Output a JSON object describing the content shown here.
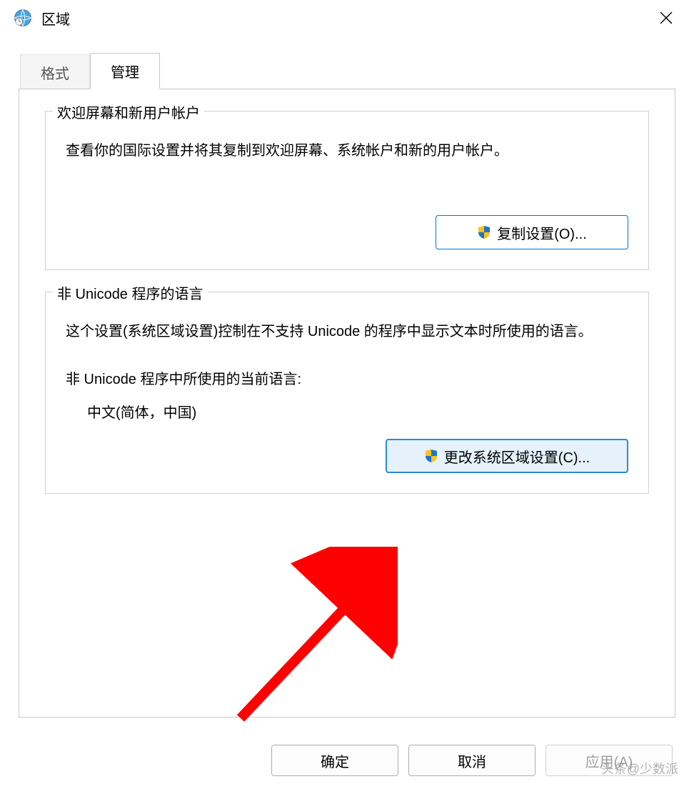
{
  "window": {
    "title": "区域"
  },
  "tabs": {
    "formats": "格式",
    "admin": "管理"
  },
  "groups": {
    "welcome": {
      "legend": "欢迎屏幕和新用户帐户",
      "desc": "查看你的国际设置并将其复制到欢迎屏幕、系统帐户和新的用户帐户。",
      "copy_btn": "复制设置(O)..."
    },
    "nonunicode": {
      "legend": "非 Unicode 程序的语言",
      "desc": "这个设置(系统区域设置)控制在不支持 Unicode 的程序中显示文本时所使用的语言。",
      "current_label": "非 Unicode 程序中所使用的当前语言:",
      "current_value": "中文(简体，中国)",
      "change_btn": "更改系统区域设置(C)..."
    }
  },
  "footer": {
    "ok": "确定",
    "cancel": "取消",
    "apply": "应用(A)"
  },
  "watermark": "头条@少数派"
}
